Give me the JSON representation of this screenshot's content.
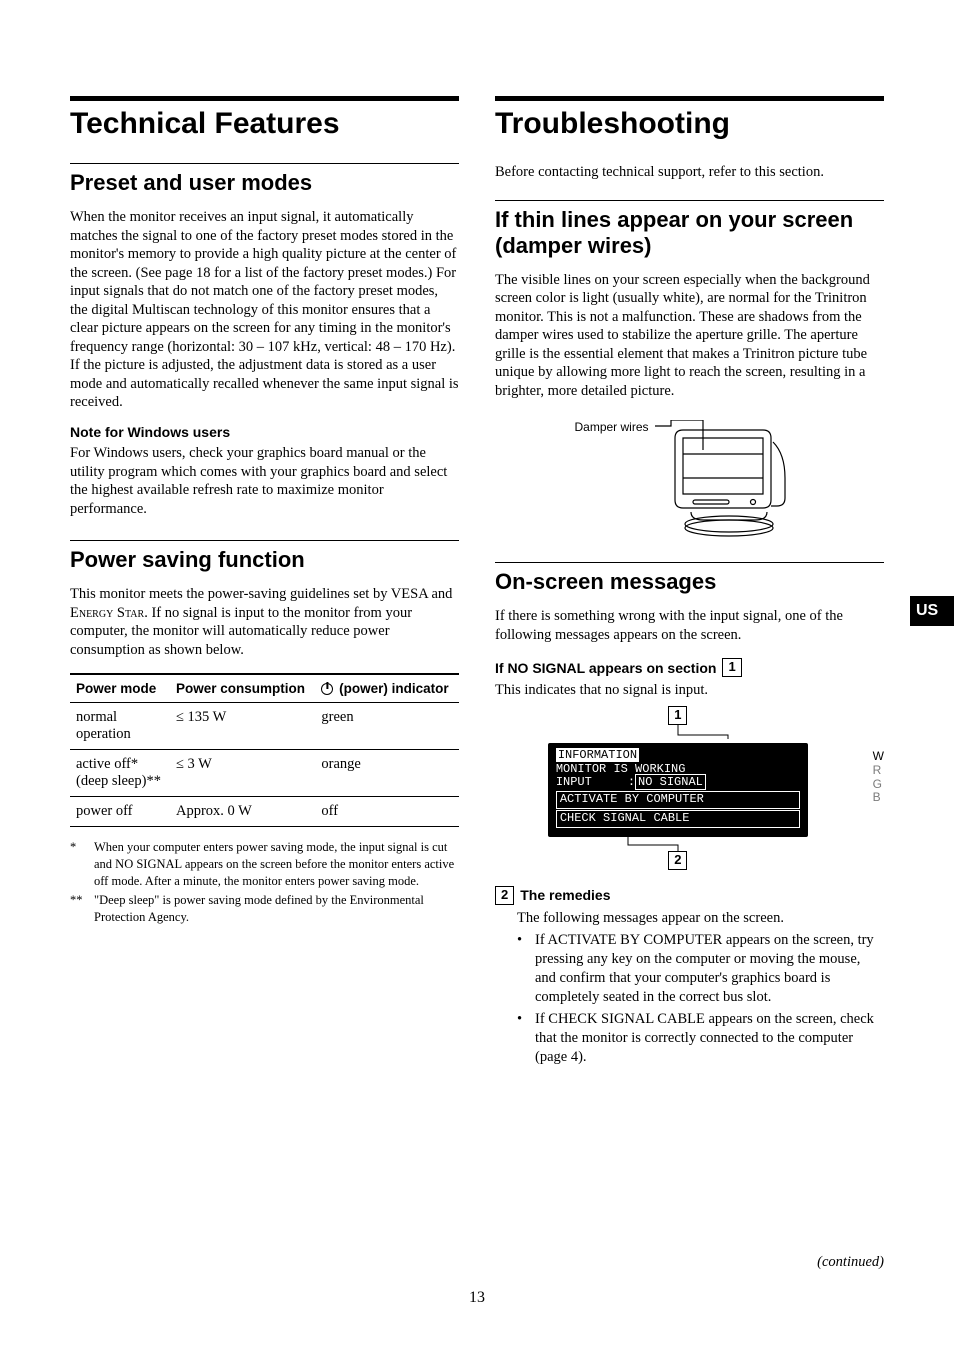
{
  "side_tab": "US",
  "page_number": "13",
  "continued": "(continued)",
  "left": {
    "title": "Technical Features",
    "preset": {
      "heading": "Preset and user modes",
      "para": "When the monitor receives an input signal, it automatically matches the signal to one of the factory preset modes stored in the monitor's memory to provide a high quality picture at the center of the screen. (See page 18 for a list of the factory preset modes.) For input signals that do not match one of the factory preset modes, the digital Multiscan technology of this monitor ensures that a clear picture appears on the screen for any timing in the monitor's frequency range (horizontal: 30 – 107 kHz, vertical: 48 – 170 Hz). If the picture is adjusted, the adjustment data is stored as a user mode and automatically recalled whenever the same input signal is received.",
      "note_heading": "Note for Windows users",
      "note_para": "For Windows users, check your graphics board manual or the utility program which comes with your graphics board and select the highest available refresh rate to maximize monitor performance."
    },
    "power": {
      "heading": "Power saving function",
      "para_pre": "This monitor meets the power-saving guidelines set by VESA and ",
      "energy_star": "Energy Star",
      "para_post": ". If no signal is input to the monitor from your computer, the monitor will automatically reduce power consumption as shown below.",
      "table_headers": {
        "mode": "Power mode",
        "consumption": "Power consumption",
        "indicator_suffix": " (power) indicator"
      },
      "rows": [
        {
          "mode_line1": "normal",
          "mode_line2": "operation",
          "consumption": "≤ 135 W",
          "indicator": "green"
        },
        {
          "mode_line1": "active off*",
          "mode_line2": "(deep sleep)**",
          "consumption": "≤ 3 W",
          "indicator": "orange"
        },
        {
          "mode_line1": "power off",
          "mode_line2": "",
          "consumption": "Approx. 0 W",
          "indicator": "off"
        }
      ],
      "footnotes": [
        {
          "mark": "*",
          "text": "When your computer enters power saving mode, the input signal is cut and NO SIGNAL appears on the screen before the monitor enters active off mode. After a minute, the monitor enters power saving mode."
        },
        {
          "mark": "**",
          "text": "\"Deep sleep\" is power saving mode defined by the Environmental Protection Agency."
        }
      ]
    }
  },
  "right": {
    "title": "Troubleshooting",
    "intro": "Before contacting technical support, refer to this section.",
    "damper": {
      "heading": "If thin lines appear on your screen (damper wires)",
      "para": "The visible lines on your screen especially when the background screen color is light (usually white), are normal for the Trinitron monitor. This is not a malfunction. These are shadows from the damper wires used to stabilize the aperture grille. The aperture grille is the essential element that makes a Trinitron picture tube unique by allowing more light to reach the screen, resulting in a brighter, more detailed picture.",
      "fig_label": "Damper wires"
    },
    "osd": {
      "heading": "On-screen messages",
      "para": "If there is something wrong with the input signal, one of the following messages appears on the screen.",
      "sub_heading": "If NO SIGNAL appears on section ",
      "callout_1": "1",
      "sub_para": "This indicates that no signal is input.",
      "osd_title": "INFORMATION",
      "osd_line1": "MONITOR IS WORKING",
      "osd_line2_pre": "INPUT     :",
      "osd_line2_box": "NO SIGNAL",
      "osd_line3": "ACTIVATE BY COMPUTER",
      "osd_line4": "CHECK SIGNAL CABLE",
      "side_letters": [
        "W",
        "R",
        "G",
        "B"
      ],
      "callout_2": "2",
      "remedies_heading": "The remedies",
      "remedies_intro": "The following messages appear on the screen.",
      "bullets": [
        "If ACTIVATE BY COMPUTER appears on the screen, try pressing any key on the computer or moving the mouse, and confirm that your computer's graphics board is completely seated in the correct bus slot.",
        "If CHECK SIGNAL CABLE appears on the screen, check that the monitor is correctly connected to the computer (page 4)."
      ]
    }
  }
}
